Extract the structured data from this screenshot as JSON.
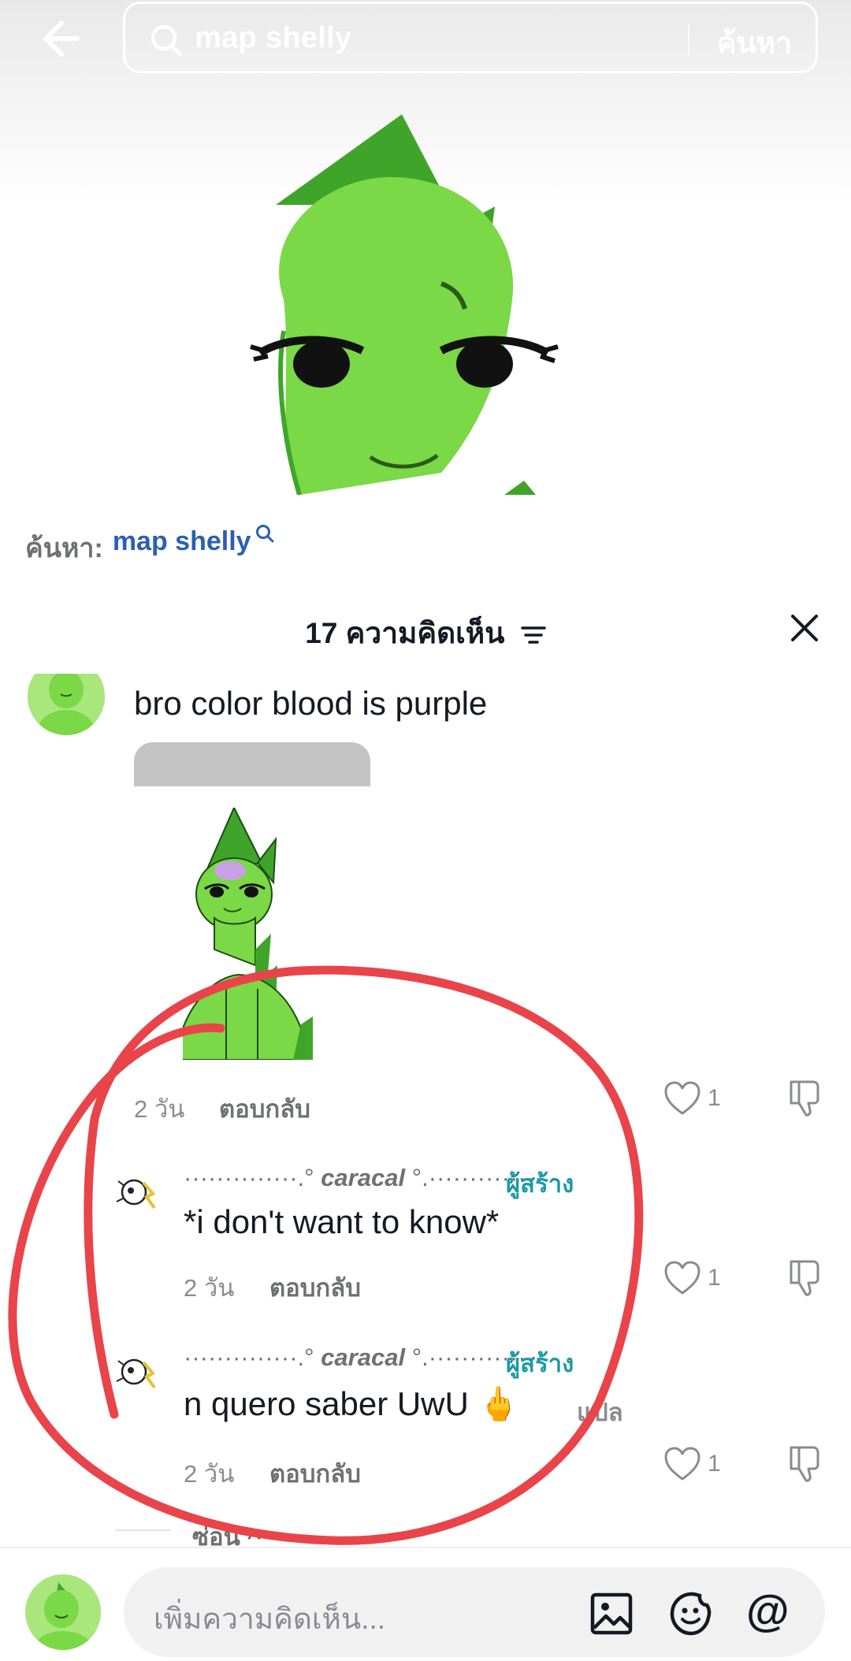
{
  "search": {
    "query": "map shelly",
    "submit_label": "ค้นหา"
  },
  "suggestion": {
    "prefix": "ค้นหา:",
    "term": "map shelly"
  },
  "comments_header": {
    "count_label": "17 ความคิดเห็น"
  },
  "comments": [
    {
      "text": "bro color blood is purple",
      "time": "2 วัน",
      "reply_label": "ตอบกลับ",
      "likes": "1"
    }
  ],
  "replies": [
    {
      "username_left": "··············.°",
      "username": "caracal",
      "username_right": "°.·············· ·",
      "creator_label": "ผู้สร้าง",
      "text": "*i don't want to know*",
      "time": "2 วัน",
      "reply_label": "ตอบกลับ",
      "likes": "1"
    },
    {
      "username_left": "··············.°",
      "username": "caracal",
      "username_right": "°.·············· ·",
      "creator_label": "ผู้สร้าง",
      "text": "n quero saber UwU 🖕",
      "translate_label": "แปล",
      "time": "2 วัน",
      "reply_label": "ตอบกลับ",
      "likes": "1"
    }
  ],
  "collapse_label": "ซ่อน ^",
  "input": {
    "placeholder": "เพิ่มความคิดเห็น...",
    "mention_symbol": "@"
  },
  "colors": {
    "character_green": "#7bd846",
    "dark_green": "#3fa52a",
    "annotation_red": "#e8444a",
    "link_blue": "#2b5fb4",
    "creator_teal": "#1c9aa5"
  },
  "icons": [
    "back-arrow-icon",
    "search-icon",
    "sort-icon",
    "close-icon",
    "heart-icon",
    "dislike-icon",
    "image-icon",
    "emoji-icon",
    "at-icon"
  ]
}
